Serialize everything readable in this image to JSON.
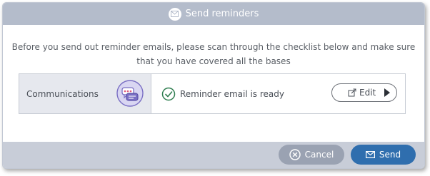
{
  "dialog": {
    "title": "Send reminders",
    "title_icon": "envelope-icon",
    "intro_line1": "Before you send out reminder emails, please scan through the checklist below and make sure",
    "intro_line2": "that you have covered all the bases"
  },
  "checklist": {
    "items": [
      {
        "label": "Communications",
        "icon": "chat-bubbles-icon",
        "status": "Reminder email is ready",
        "status_icon": "check-circle-icon",
        "edit_label": "Edit",
        "edit_icon": "external-edit-icon",
        "arrow_icon": "caret-right-icon"
      }
    ]
  },
  "footer": {
    "cancel_label": "Cancel",
    "cancel_icon": "x-circle-icon",
    "send_label": "Send",
    "send_icon": "envelope-icon"
  },
  "colors": {
    "titlebar": "#b4bccb",
    "footer": "#c8cdd8",
    "send_button": "#2f6eae",
    "cancel_button": "#9aa2b2",
    "check_green": "#2e7d4f",
    "icon_purple": "#7a6fc4"
  }
}
